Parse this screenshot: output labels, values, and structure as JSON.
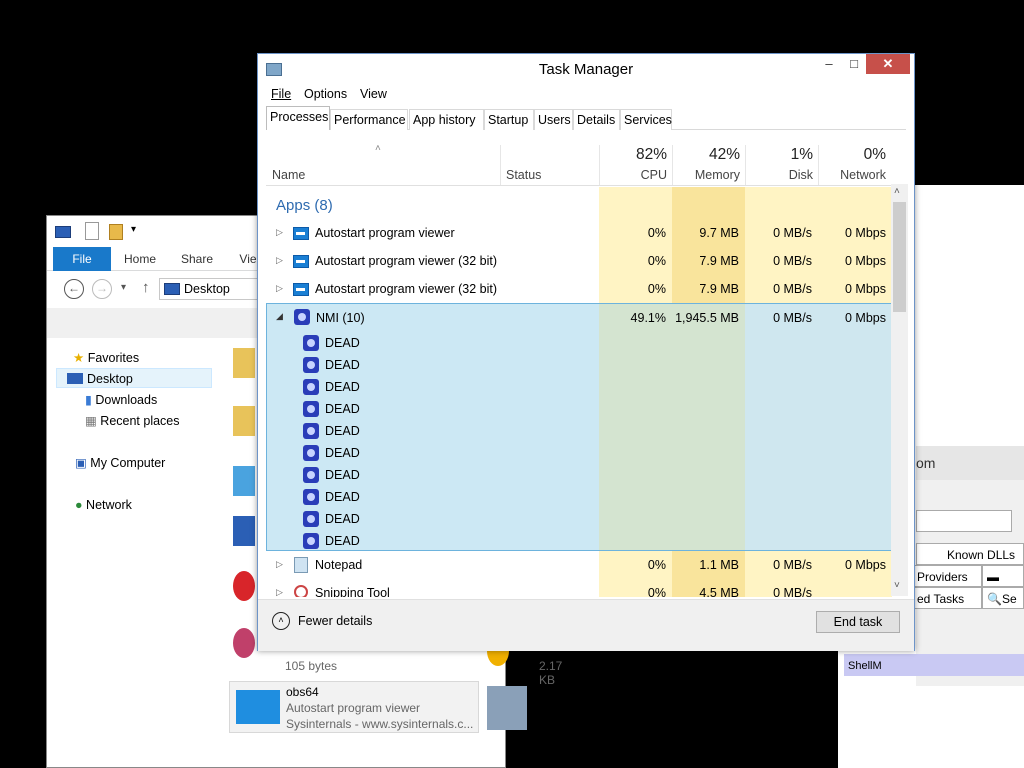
{
  "taskmanager": {
    "title": "Task Manager",
    "menu": [
      "File",
      "Options",
      "View"
    ],
    "tabs": [
      "Processes",
      "Performance",
      "App history",
      "Startup",
      "Users",
      "Details",
      "Services"
    ],
    "columns": {
      "name": "Name",
      "status": "Status",
      "cpu_pct": "82%",
      "cpu": "CPU",
      "mem_pct": "42%",
      "mem": "Memory",
      "disk_pct": "1%",
      "disk": "Disk",
      "net_pct": "0%",
      "net": "Network"
    },
    "group_label": "Apps (8)",
    "rows": [
      {
        "name": "Autostart program viewer",
        "cpu": "0%",
        "mem": "9.7 MB",
        "disk": "0 MB/s",
        "net": "0 Mbps"
      },
      {
        "name": "Autostart program viewer (32 bit)",
        "cpu": "0%",
        "mem": "7.9 MB",
        "disk": "0 MB/s",
        "net": "0 Mbps"
      },
      {
        "name": "Autostart program viewer (32 bit)",
        "cpu": "0%",
        "mem": "7.9 MB",
        "disk": "0 MB/s",
        "net": "0 Mbps"
      }
    ],
    "nmi": {
      "name": "NMI (10)",
      "cpu": "49.1%",
      "mem": "1,945.5 MB",
      "disk": "0 MB/s",
      "net": "0 Mbps"
    },
    "dead": [
      "DEAD",
      "DEAD",
      "DEAD",
      "DEAD",
      "DEAD",
      "DEAD",
      "DEAD",
      "DEAD",
      "DEAD",
      "DEAD"
    ],
    "notepad": {
      "name": "Notepad",
      "cpu": "0%",
      "mem": "1.1 MB",
      "disk": "0 MB/s",
      "net": "0 Mbps"
    },
    "snipping": {
      "name": "Snipping Tool",
      "cpu": "0%",
      "mem": "4.5 MB",
      "disk": "0 MB/s"
    },
    "fewer_details": "Fewer details",
    "end_task": "End task"
  },
  "explorer": {
    "ribbon_tabs": [
      "File",
      "Home",
      "Share",
      "Vie"
    ],
    "address": "Desktop",
    "nav": [
      "Favorites",
      "Desktop",
      "Downloads",
      "Recent places",
      "My Computer",
      "Network"
    ],
    "files": [
      {
        "size": "105 bytes"
      },
      {
        "size": "2.17 KB"
      },
      {
        "name": "obs64",
        "desc": "Autostart program viewer",
        "company": "Sysinternals - www.sysinternals.c..."
      }
    ]
  },
  "procexp": {
    "title_tail": "om",
    "tabs": [
      "Known DLLs",
      "Providers",
      "ed Tasks",
      "Se"
    ],
    "band_text": "ShellM"
  },
  "colors": {
    "accent": "#1979ca",
    "highlight": "#cce8f4",
    "heat": "#fff4c4"
  }
}
